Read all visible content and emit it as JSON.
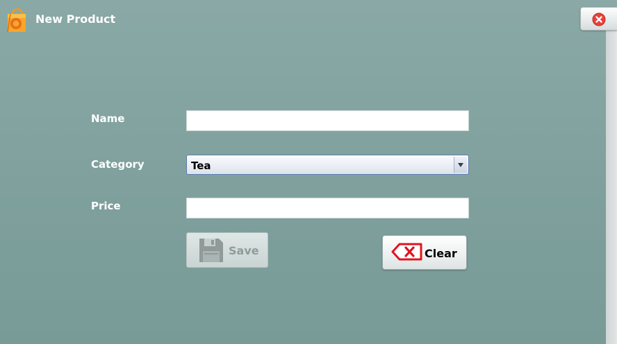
{
  "window": {
    "title": "New Product",
    "app_icon": "shopping-bag-icon",
    "close_icon": "close-icon"
  },
  "form": {
    "name": {
      "label": "Name",
      "value": ""
    },
    "category": {
      "label": "Category",
      "selected": "Tea"
    },
    "price": {
      "label": "Price",
      "value": ""
    }
  },
  "buttons": {
    "save": {
      "label": "Save",
      "icon": "floppy-disk-icon",
      "enabled": false
    },
    "clear": {
      "label": "Clear",
      "icon": "backspace-clear-icon"
    }
  },
  "colors": {
    "background": "#8aa9a6",
    "close_red": "#e8413a",
    "clear_icon_red": "#e0141e",
    "bag_orange": "#f39a1e"
  }
}
